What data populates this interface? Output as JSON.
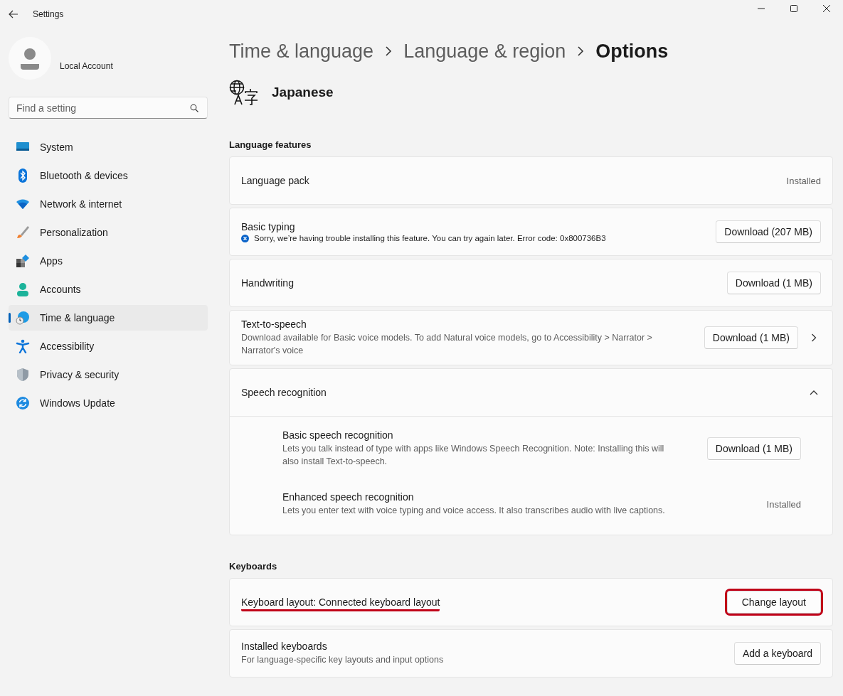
{
  "window": {
    "title": "Settings"
  },
  "account": {
    "name": "Local Account"
  },
  "search": {
    "placeholder": "Find a setting"
  },
  "sidebar": {
    "items": [
      {
        "label": "System",
        "selected": false
      },
      {
        "label": "Bluetooth & devices",
        "selected": false
      },
      {
        "label": "Network & internet",
        "selected": false
      },
      {
        "label": "Personalization",
        "selected": false
      },
      {
        "label": "Apps",
        "selected": false
      },
      {
        "label": "Accounts",
        "selected": false
      },
      {
        "label": "Time & language",
        "selected": true
      },
      {
        "label": "Accessibility",
        "selected": false
      },
      {
        "label": "Privacy & security",
        "selected": false
      },
      {
        "label": "Windows Update",
        "selected": false
      }
    ]
  },
  "breadcrumb": [
    "Time & language",
    "Language & region",
    "Options"
  ],
  "language": {
    "name": "Japanese"
  },
  "sections": [
    {
      "heading": "Language features",
      "cards": [
        {
          "kind": "status",
          "title": "Language pack",
          "status": "Installed"
        },
        {
          "kind": "action",
          "title": "Basic typing",
          "error": "Sorry, we’re having trouble installing this feature. You can try again later. Error code: 0x800736B3",
          "button": "Download (207 MB)"
        },
        {
          "kind": "action",
          "title": "Handwriting",
          "button": "Download (1 MB)"
        },
        {
          "kind": "action",
          "title": "Text-to-speech",
          "description": "Download available for Basic voice models. To add Natural voice models, go to Accessibility > Narrator > Narrator's voice",
          "button": "Download (1 MB)",
          "navigable": true
        },
        {
          "kind": "expander",
          "title": "Speech recognition",
          "expanded": true,
          "children": [
            {
              "kind": "action",
              "title": "Basic speech recognition",
              "description": "Lets you talk instead of type with apps like Windows Speech Recognition. Note: Installing this will also install Text-to-speech.",
              "button": "Download (1 MB)"
            },
            {
              "kind": "status",
              "title": "Enhanced speech recognition",
              "description": "Lets you enter text with voice typing and voice access. It also transcribes audio with live captions.",
              "status": "Installed"
            }
          ]
        }
      ]
    },
    {
      "heading": "Keyboards",
      "cards": [
        {
          "kind": "action",
          "title": "Keyboard layout: Connected keyboard layout",
          "button": "Change layout",
          "highlighted": true
        },
        {
          "kind": "action",
          "title": "Installed keyboards",
          "description": "For language-specific key layouts and input options",
          "button": "Add a keyboard"
        }
      ]
    }
  ]
}
